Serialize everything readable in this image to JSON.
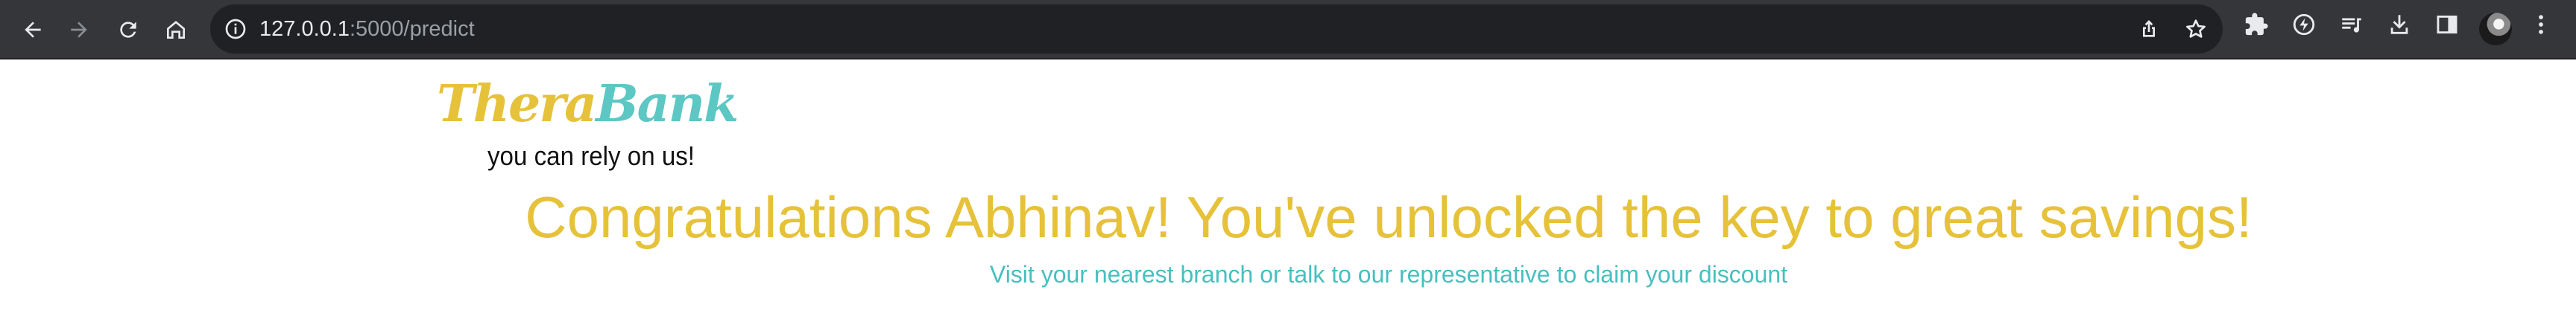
{
  "browser": {
    "url_host": "127.0.0.1",
    "url_rest": ":5000/predict",
    "icons": [
      "back-icon",
      "forward-icon",
      "reload-icon",
      "home-icon",
      "info-icon",
      "share-icon",
      "star-icon",
      "extensions-icon",
      "sync-icon",
      "reading-list-icon",
      "download-icon",
      "sidepanel-icon",
      "menu-icon"
    ]
  },
  "page": {
    "logo_part1": "Thera",
    "logo_part2": "Bank",
    "tagline": "you can rely on us!",
    "headline": "Congratulations Abhinav! You've unlocked the key to great savings!",
    "subline": "Visit your nearest branch or talk to our representative to claim your discount"
  },
  "colors": {
    "chrome_bg": "#35363a",
    "omnibox_bg": "#202124",
    "brand_gold": "#e6c23a",
    "brand_teal": "#5cc7c3",
    "subline_teal": "#48bfbf"
  }
}
